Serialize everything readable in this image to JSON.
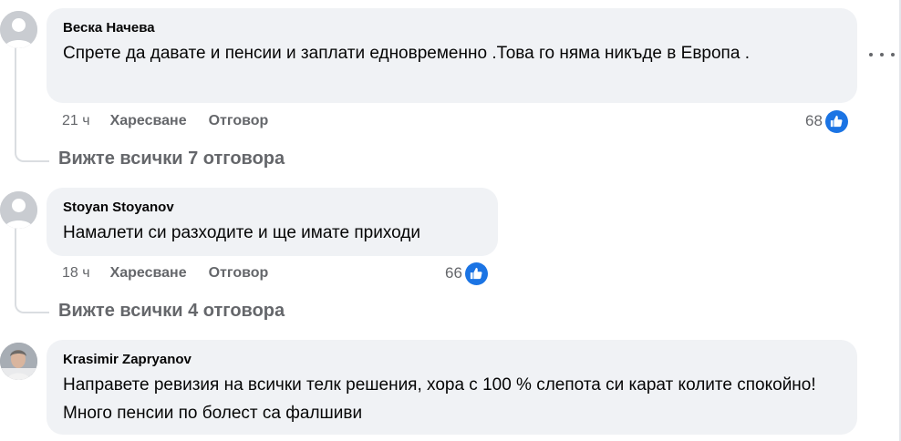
{
  "comments": [
    {
      "author": "Веска Начева",
      "text": "Спрете да давате и пенсии и заплати едновременно .Това го няма никъде в Европа .",
      "time": "21 ч",
      "like_label": "Харесване",
      "reply_label": "Отговор",
      "reactions": "68",
      "view_replies": "Вижте всички 7 отговора",
      "avatar": "default-avatar"
    },
    {
      "author": "Stoyan Stoyanov",
      "text": "Намалети си разходите и ще имате приходи",
      "time": "18 ч",
      "like_label": "Харесване",
      "reply_label": "Отговор",
      "reactions": "66",
      "view_replies": "Вижте всички 4 отговора",
      "avatar": "default-avatar"
    },
    {
      "author": "Krasimir Zapryanov",
      "text": "Направете ревизия на всички телк решения, хора с 100 % слепота си карат колите спокойно! Много пенсии по болест са фалшиви",
      "avatar": "photo-avatar"
    }
  ],
  "icons": {
    "like": "thumbs-up-icon",
    "more": "more-options-icon"
  },
  "colors": {
    "bubble": "#f0f2f5",
    "secondary_text": "#65676b",
    "like_blue": "#1b74e4"
  }
}
